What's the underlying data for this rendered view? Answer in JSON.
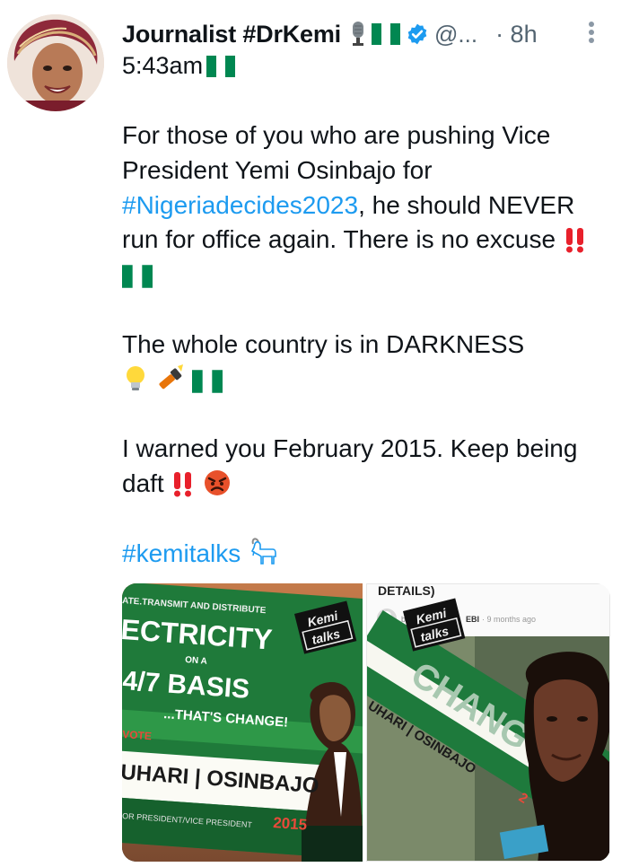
{
  "author": {
    "name": "Journalist #DrKemi",
    "handle": "@...",
    "time": "· 8h",
    "icons": [
      "microphone-icon",
      "nigeria-flag-icon",
      "verified-badge-icon"
    ]
  },
  "subtime": "5:43am",
  "tweet": {
    "p1_text": "For those of you who are pushing Vice President Yemi Osinbajo for ",
    "p1_hashtag": "#Nigeriadecides2023",
    "p1_text2": ", he should NEVER run for office again. There is no excuse",
    "p2_text": "The whole country is in DARKNESS",
    "p3_text": "I warned you February 2015. Keep being daft",
    "p4_hashtag": "#kemitalks"
  },
  "media": {
    "left": {
      "line1": "ATE.TRANSMIT AND DISTRIBUTE",
      "line2": "ECTRICITY",
      "line3": "ON A",
      "line4": "4/7 BASIS",
      "line5": "...THAT'S CHANGE!",
      "line6": "VOTE",
      "line7": "UHARI | OSINBAJO",
      "line8": "OR PRESIDENT/VICE PRESIDENT",
      "year": "2015",
      "watermark1": "Kemi",
      "watermark2": "talks"
    },
    "right": {
      "header": "DETAILS)",
      "byline": "b",
      "byline_name": "EBI",
      "byline_time": "· 9 months ago",
      "banner_word": "CHANG",
      "banner_text": "UHARI | OSINBAJO",
      "banner_year": "2",
      "watermark1": "Kemi",
      "watermark2": "talks"
    }
  },
  "colors": {
    "hashtag": "#1d9bf0",
    "secondary_text": "#536471",
    "verified": "#1d9bf0",
    "nigeria_green": "#008751"
  }
}
